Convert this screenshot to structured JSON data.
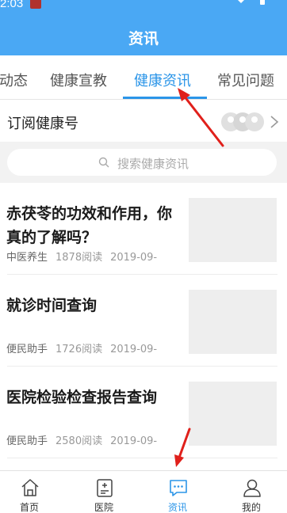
{
  "status_bar": {
    "time": "2:03"
  },
  "header": {
    "title": "资讯"
  },
  "tabs": [
    {
      "label": "动态",
      "active": false
    },
    {
      "label": "健康宣教",
      "active": false
    },
    {
      "label": "健康资讯",
      "active": true
    },
    {
      "label": "常见问题",
      "active": false
    }
  ],
  "subscribe": {
    "label": "订阅健康号"
  },
  "search": {
    "placeholder": "搜索健康资讯"
  },
  "articles": [
    {
      "title": "赤茯苓的功效和作用，你真的了解吗？",
      "source": "中医养生",
      "views": "1878阅读",
      "date": "2019-09-"
    },
    {
      "title": "就诊时间查询",
      "source": "便民助手",
      "views": "1726阅读",
      "date": "2019-09-"
    },
    {
      "title": "医院检验检查报告查询",
      "source": "便民助手",
      "views": "2580阅读",
      "date": "2019-09-"
    }
  ],
  "bottom_nav": [
    {
      "label": "首页",
      "icon": "home-icon",
      "active": false
    },
    {
      "label": "医院",
      "icon": "hospital-icon",
      "active": false
    },
    {
      "label": "资讯",
      "icon": "message-icon",
      "active": true
    },
    {
      "label": "我的",
      "icon": "profile-icon",
      "active": false
    }
  ],
  "colors": {
    "header_bg": "#4aa8f4",
    "accent": "#2b95e8",
    "annotation_arrow": "#e0201b"
  }
}
